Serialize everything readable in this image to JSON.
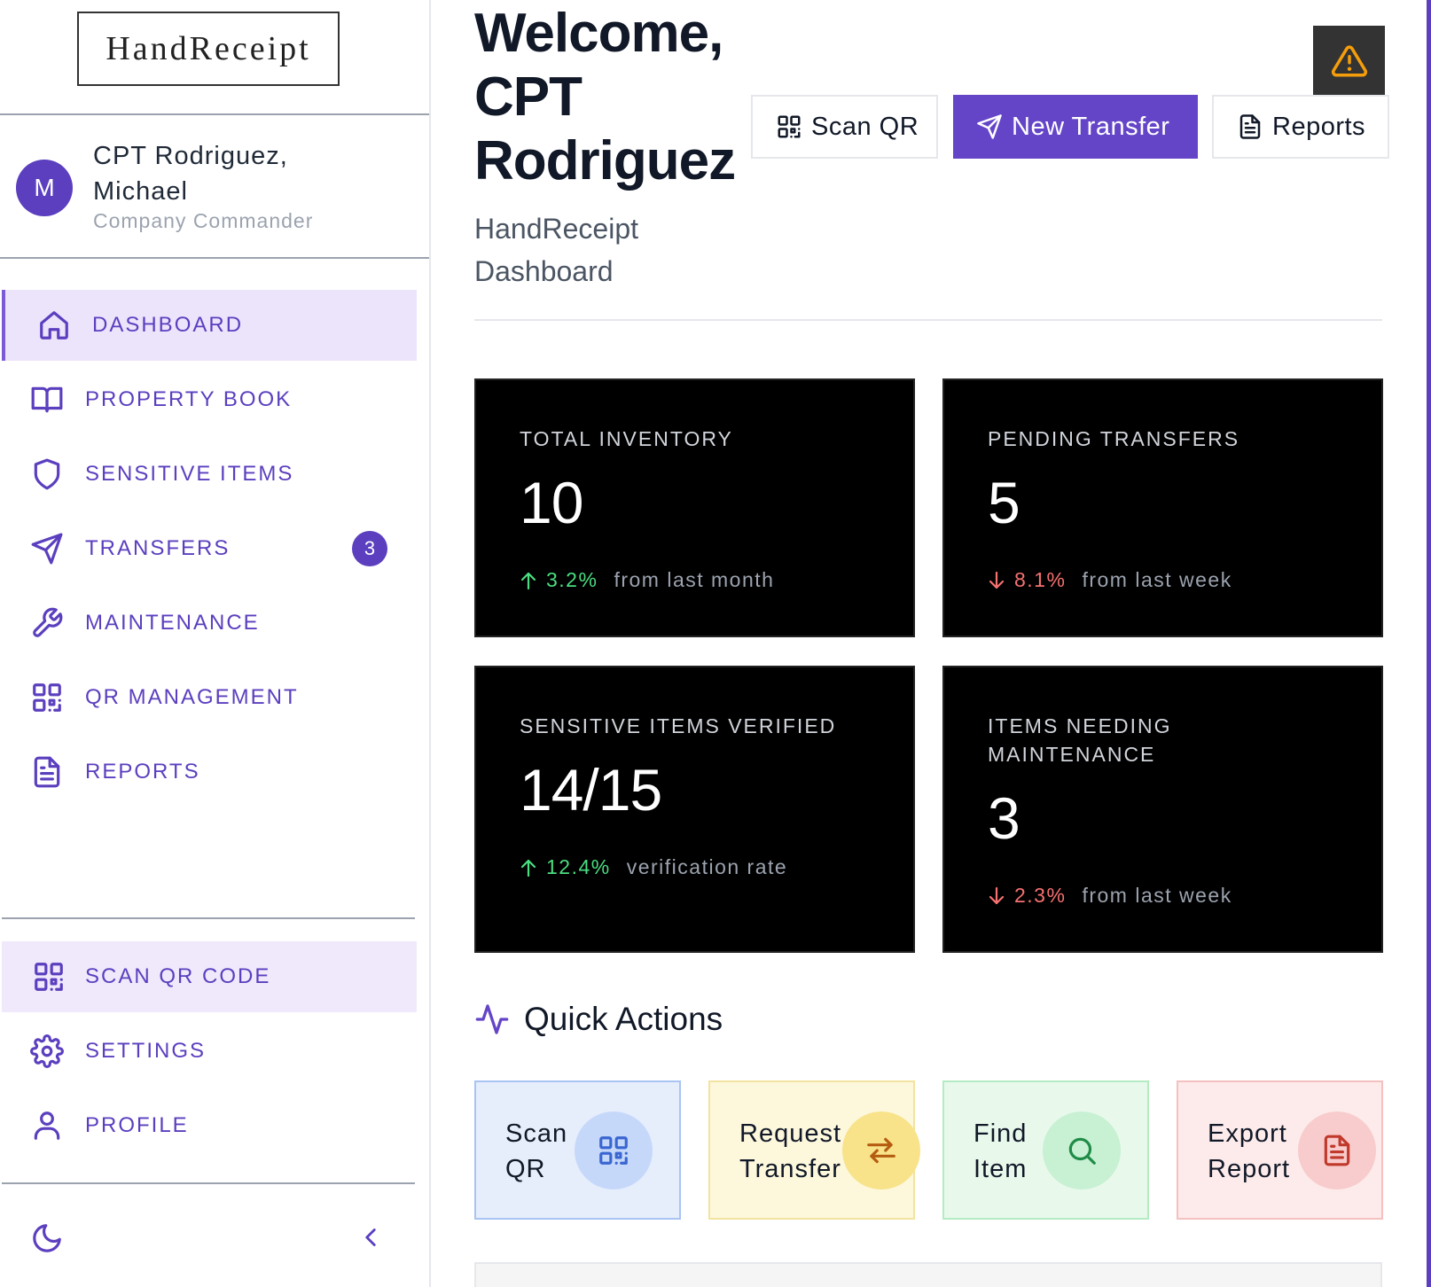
{
  "app": {
    "logo_text": "HandReceipt"
  },
  "user": {
    "initial": "M",
    "name": "CPT Rodriguez, Michael",
    "role": "Company Commander"
  },
  "sidebar": {
    "items": [
      {
        "label": "DASHBOARD",
        "icon": "home-icon",
        "active": true
      },
      {
        "label": "PROPERTY BOOK",
        "icon": "book-icon"
      },
      {
        "label": "SENSITIVE ITEMS",
        "icon": "shield-icon"
      },
      {
        "label": "TRANSFERS",
        "icon": "send-icon",
        "badge": "3"
      },
      {
        "label": "MAINTENANCE",
        "icon": "wrench-icon"
      },
      {
        "label": "QR MANAGEMENT",
        "icon": "qr-icon"
      },
      {
        "label": "REPORTS",
        "icon": "document-icon"
      }
    ],
    "bottom_items": [
      {
        "label": "SCAN QR CODE",
        "icon": "qr-icon",
        "highlight": true
      },
      {
        "label": "SETTINGS",
        "icon": "gear-icon"
      },
      {
        "label": "PROFILE",
        "icon": "user-icon"
      }
    ],
    "footer_icons": [
      "moon-icon",
      "chevron-left-icon"
    ]
  },
  "header": {
    "welcome": "Welcome, CPT Rodriguez",
    "subtitle": "HandReceipt Dashboard",
    "buttons": {
      "scan_qr": "Scan QR",
      "new_transfer": "New Transfer",
      "reports": "Reports"
    },
    "alert_icon": "warning-triangle-icon"
  },
  "stats": [
    {
      "label": "TOTAL INVENTORY",
      "value": "10",
      "change": "3.2%",
      "direction": "up",
      "note": "from last month"
    },
    {
      "label": "PENDING TRANSFERS",
      "value": "5",
      "change": "8.1%",
      "direction": "down",
      "note": "from last week"
    },
    {
      "label": "SENSITIVE ITEMS VERIFIED",
      "value": "14/15",
      "change": "12.4%",
      "direction": "up",
      "note": "verification rate"
    },
    {
      "label": "ITEMS NEEDING MAINTENANCE",
      "value": "3",
      "change": "2.3%",
      "direction": "down",
      "note": "from last week"
    }
  ],
  "quick_actions": {
    "title": "Quick Actions",
    "items": [
      {
        "label": "Scan QR",
        "icon": "qr-icon",
        "color": "#3a66d1"
      },
      {
        "label": "Request Transfer",
        "icon": "swap-arrows-icon",
        "color": "#b45d10"
      },
      {
        "label": "Find Item",
        "icon": "search-icon",
        "color": "#1f8c46"
      },
      {
        "label": "Export Report",
        "icon": "document-icon",
        "color": "#c0392b"
      }
    ]
  },
  "colors": {
    "accent": "#6445c8",
    "up": "#4ade80",
    "down": "#f87171"
  }
}
